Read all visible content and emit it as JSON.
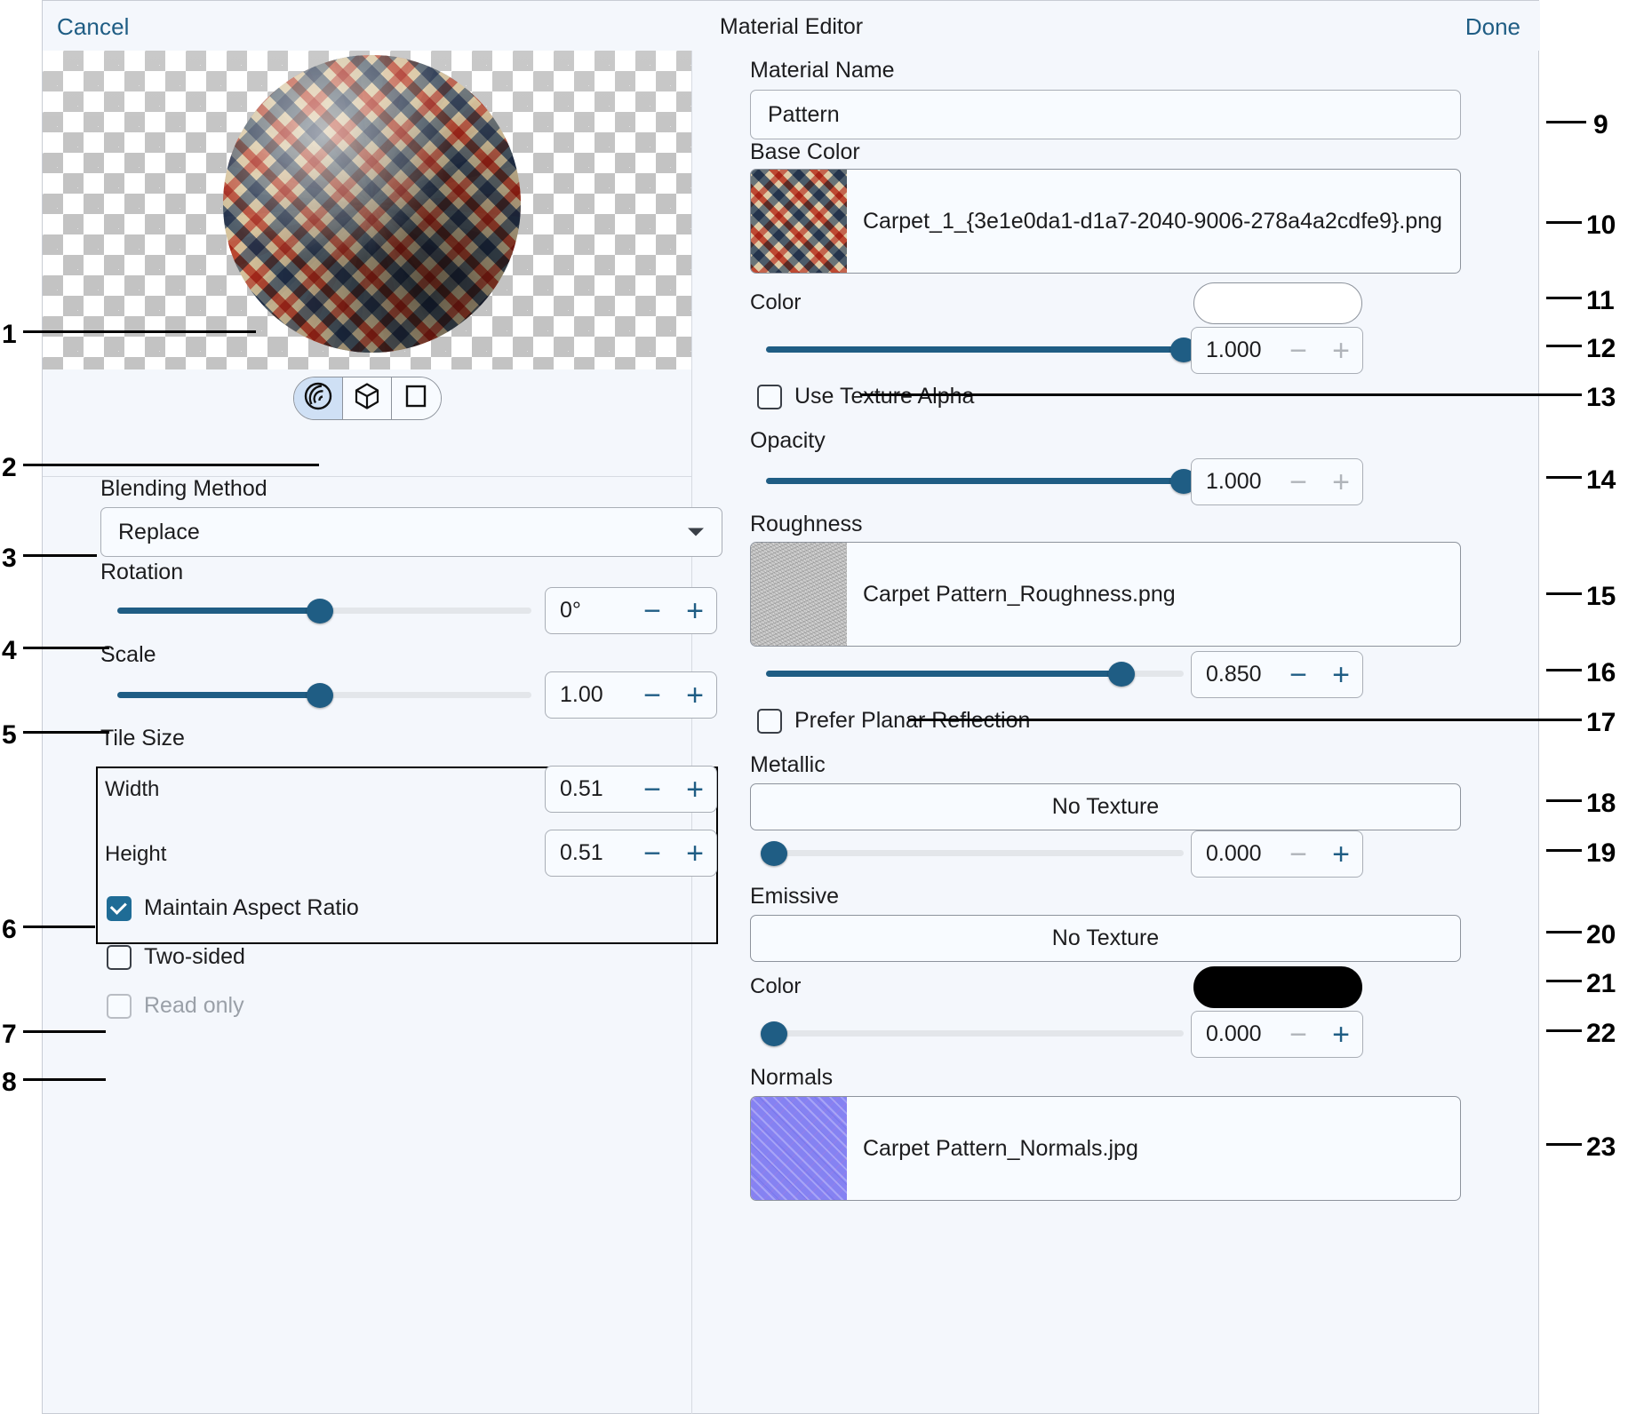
{
  "header": {
    "cancel_label": "Cancel",
    "title": "Material Editor",
    "done_label": "Done"
  },
  "preview": {
    "shape_options": [
      "sphere",
      "cube",
      "plane"
    ],
    "selected_shape": "sphere",
    "icons": [
      "sphere-icon",
      "cube-icon",
      "plane-icon"
    ]
  },
  "left_panel": {
    "blending_method": {
      "label": "Blending Method",
      "value": "Replace",
      "options": [
        "Replace"
      ]
    },
    "rotation": {
      "label": "Rotation",
      "value": "0°",
      "slider_percent": 49
    },
    "scale": {
      "label": "Scale",
      "value": "1.00",
      "slider_percent": 49
    },
    "tile_size": {
      "label": "Tile Size",
      "width_label": "Width",
      "width_value": "0.51",
      "height_label": "Height",
      "height_value": "0.51",
      "maintain_aspect_label": "Maintain Aspect Ratio",
      "maintain_aspect_checked": true
    },
    "two_sided": {
      "label": "Two-sided",
      "checked": false
    },
    "read_only": {
      "label": "Read only",
      "checked": false,
      "disabled": true
    }
  },
  "right_panel": {
    "material_name": {
      "label": "Material Name",
      "value": "Pattern"
    },
    "base_color": {
      "label": "Base Color",
      "texture_name": "Carpet_1_{3e1e0da1-d1a7-2040-9006-278a4a2cdfe9}.png",
      "color_label": "Color",
      "color_swatch": "#ffffff",
      "value": "1.000",
      "slider_percent": 100
    },
    "use_texture_alpha": {
      "label": "Use Texture Alpha",
      "checked": false
    },
    "opacity": {
      "label": "Opacity",
      "value": "1.000",
      "slider_percent": 100
    },
    "roughness": {
      "label": "Roughness",
      "texture_name": "Carpet Pattern_Roughness.png",
      "value": "0.850",
      "slider_percent": 85
    },
    "prefer_planar_reflection": {
      "label": "Prefer Planar Reflection",
      "checked": false
    },
    "metallic": {
      "label": "Metallic",
      "texture_name": "No Texture",
      "value": "0.000",
      "slider_percent": 0
    },
    "emissive": {
      "label": "Emissive",
      "texture_name": "No Texture",
      "color_label": "Color",
      "color_swatch": "#000000",
      "value": "0.000",
      "slider_percent": 0
    },
    "normals": {
      "label": "Normals",
      "texture_name": "Carpet Pattern_Normals.jpg"
    }
  },
  "stepper_icons": {
    "minus": "−",
    "plus": "+"
  },
  "callouts": [
    {
      "n": "1"
    },
    {
      "n": "2"
    },
    {
      "n": "3"
    },
    {
      "n": "4"
    },
    {
      "n": "5"
    },
    {
      "n": "6"
    },
    {
      "n": "7"
    },
    {
      "n": "8"
    },
    {
      "n": "9"
    },
    {
      "n": "10"
    },
    {
      "n": "11"
    },
    {
      "n": "12"
    },
    {
      "n": "13"
    },
    {
      "n": "14"
    },
    {
      "n": "15"
    },
    {
      "n": "16"
    },
    {
      "n": "17"
    },
    {
      "n": "18"
    },
    {
      "n": "19"
    },
    {
      "n": "20"
    },
    {
      "n": "21"
    },
    {
      "n": "22"
    },
    {
      "n": "23"
    }
  ],
  "colors": {
    "accent": "#1f5d84",
    "panel_bg": "#f4f7fc",
    "field_bg": "#f8fbff",
    "border": "#a9aeb6"
  }
}
